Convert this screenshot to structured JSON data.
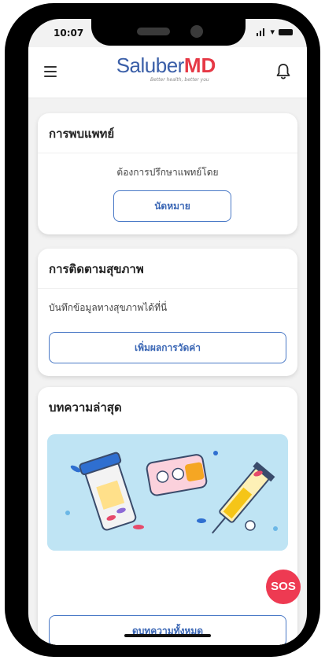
{
  "status": {
    "time": "10:07"
  },
  "header": {
    "brand_prefix": "Saluber",
    "brand_suffix": "MD",
    "tagline": "Better health, better you"
  },
  "doctor_card": {
    "title": "การพบแพทย์",
    "subtitle": "ต้องการปรึกษาแพทย์โดย",
    "button": "นัดหมาย"
  },
  "health_card": {
    "title": "การติดตามสุขภาพ",
    "subtitle": "บันทึกข้อมูลทางสุขภาพได้ที่นี่",
    "button": "เพิ่มผลการวัดค่า"
  },
  "articles_card": {
    "title": "บทความล่าสุด",
    "button": "ดูบทความทั้งหมด"
  },
  "sos": {
    "label": "SOS"
  },
  "colors": {
    "brand_blue": "#3b5fa8",
    "brand_red": "#e63946",
    "button_border": "#4a79c6",
    "sos_red": "#ee3a52",
    "article_bg": "#bfe4f4"
  }
}
